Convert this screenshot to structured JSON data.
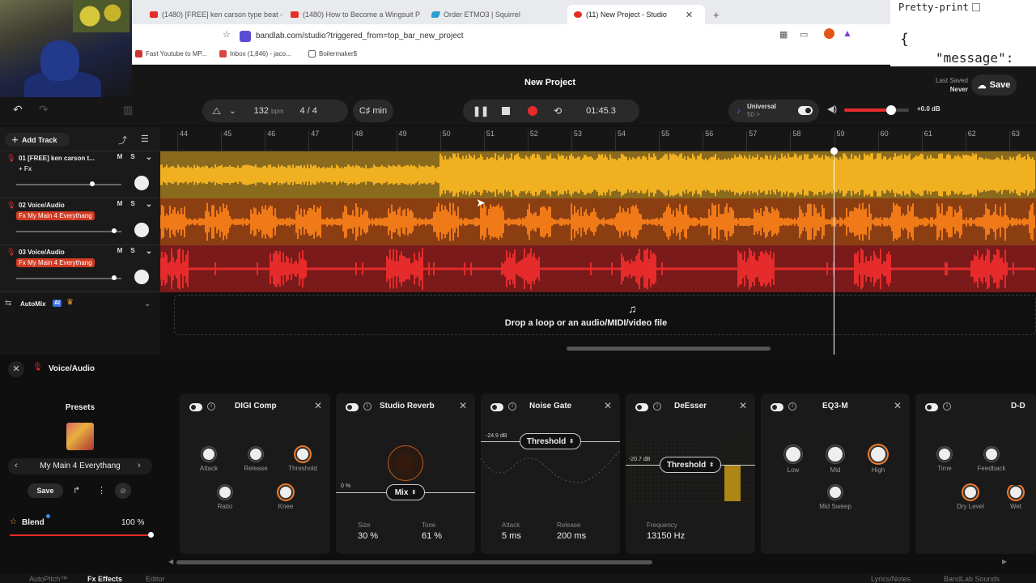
{
  "browser": {
    "tabs": [
      {
        "label": "(1480) [FREE] ken carson type beat -",
        "icon": "youtube-icon"
      },
      {
        "label": "(1480) How to Become a Wingsuit P",
        "icon": "youtube-icon"
      },
      {
        "label": "Order ETMO3 | Squirrel",
        "icon": "squirrel-icon"
      },
      {
        "label": "(11) New Project - Studio",
        "icon": "bandlab-icon"
      }
    ],
    "new_tab": "+",
    "url": "bandlab.com/studio?triggered_from=top_bar_new_project",
    "bookmarks": [
      "Fast Youtube to MP...",
      "Inbox (1,846) - jaco...",
      "Boilermaker$"
    ]
  },
  "json_viewer": {
    "pretty_print": "Pretty-print",
    "brace": "{",
    "key": "\"message\":"
  },
  "studio": {
    "title": "New Project",
    "last_saved_label": "Last Saved",
    "last_saved_value": "Never",
    "save_label": "Save",
    "bpm": "132",
    "bpm_unit": "bpm",
    "time_sig": "4 / 4",
    "key": "C♯ min",
    "time": "01:45.3",
    "instrument_name": "Universal",
    "instrument_sub": "50 >",
    "master_level": "+0.0 dB",
    "master_volume_fraction": 0.72,
    "add_track": "Add Track",
    "ruler": [
      "44",
      "45",
      "46",
      "47",
      "48",
      "49",
      "50",
      "51",
      "52",
      "53",
      "54",
      "55",
      "56",
      "57",
      "58",
      "59",
      "60",
      "61",
      "62",
      "63"
    ],
    "tracks": [
      {
        "name": "01 [FREE] ken carson t...",
        "fx": "+ Fx",
        "fx_plain": true,
        "volume": 0.72,
        "color": "#f0b020"
      },
      {
        "name": "02 Voice/Audio",
        "fx": "Fx My Main 4 Everythang",
        "fx_plain": false,
        "volume": 0.93,
        "color": "#f07a18"
      },
      {
        "name": "03 Voice/Audio",
        "fx": "Fx My Main 4 Everythang",
        "fx_plain": false,
        "volume": 0.93,
        "color": "#e52b2b"
      }
    ],
    "mute": "M",
    "solo": "S",
    "automix": "AutoMix",
    "automix_badge": "AI",
    "drop_text": "Drop a loop or an audio/MIDI/video file"
  },
  "fx_panel": {
    "track_label": "Voice/Audio",
    "presets_title": "Presets",
    "preset_name": "My Main 4 Everythang",
    "save_label": "Save",
    "blend_label": "Blend",
    "blend_value": "100 %",
    "blend_fraction": 1.0,
    "effects": {
      "digi_comp": {
        "title": "DIGI Comp",
        "knobs": [
          "Attack",
          "Release",
          "Threshold",
          "Ratio",
          "Knee"
        ]
      },
      "reverb": {
        "title": "Studio Reverb",
        "mix_label": "Mix",
        "zero": "0 %",
        "size_label": "Size",
        "size_value": "30 %",
        "tone_label": "Tone",
        "tone_value": "61 %"
      },
      "noise_gate": {
        "title": "Noise Gate",
        "level": "-24.9 dB",
        "threshold_label": "Threshold",
        "attack_label": "Attack",
        "attack_value": "5 ms",
        "release_label": "Release",
        "release_value": "200 ms"
      },
      "deesser": {
        "title": "DeEsser",
        "level": "-20.7 dB",
        "threshold_label": "Threshold",
        "freq_label": "Frequency",
        "freq_value": "13150 Hz"
      },
      "eq": {
        "title": "EQ3-M",
        "knobs": [
          "Low",
          "Mid",
          "High",
          "Mid Sweep"
        ]
      },
      "delay": {
        "title": "D-D",
        "knobs": [
          "Time",
          "Feedback",
          "Dry Level",
          "Wet"
        ]
      }
    }
  },
  "bottom_tabs": [
    "AutoPitch™",
    "Fx Effects",
    "Editor",
    "Lyrics/Notes",
    "BandLab Sounds"
  ],
  "colors": {
    "accent_red": "#e52b2b",
    "orange": "#f07a18",
    "yellow": "#f0b020"
  }
}
